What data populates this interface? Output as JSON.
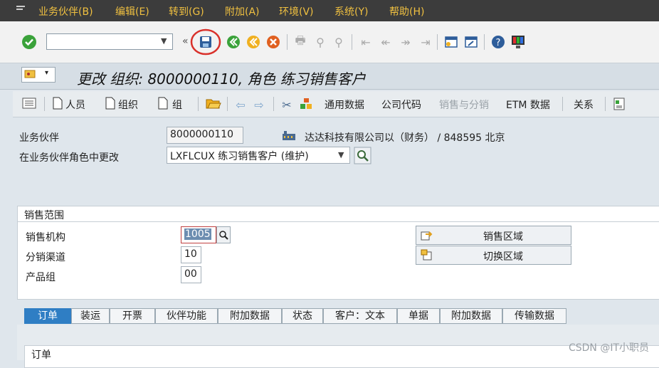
{
  "menu": {
    "items": [
      "业务伙伴(B)",
      "编辑(E)",
      "转到(G)",
      "附加(A)",
      "环境(V)",
      "系统(Y)",
      "帮助(H)"
    ]
  },
  "toolbar": {
    "command_value": "",
    "icons": [
      "check-icon",
      "save-icon",
      "back-icon",
      "exit-icon",
      "cancel-icon",
      "print-icon",
      "find-icon",
      "find-next-icon",
      "first-page-icon",
      "prev-page-icon",
      "next-page-icon",
      "last-page-icon",
      "new-session-icon",
      "shortcut-icon",
      "help-icon",
      "layout-icon"
    ]
  },
  "title": "更改 组织: 8000000110, 角色 练习销售客户",
  "app_toolbar": {
    "person": "人员",
    "org": "组织",
    "group": "组",
    "general_data": "通用数据",
    "company_code": "公司代码",
    "sales_distribution": "销售与分销",
    "etm_data": "ETM 数据",
    "relations": "关系"
  },
  "header": {
    "bp_label": "业务伙伴",
    "bp_value": "8000000110",
    "bp_desc": "达达科技有限公司以（财务） / 848595 北京",
    "role_label": "在业务伙伴角色中更改",
    "role_value": "LXFLCUX 练习销售客户 (维护)"
  },
  "sales_area": {
    "title": "销售范围",
    "sales_org_label": "销售机构",
    "sales_org_value": "1005",
    "channel_label": "分销渠道",
    "channel_value": "10",
    "division_label": "产品组",
    "division_value": "00",
    "sales_areas_button": "销售区域",
    "switch_area_button": "切换区域"
  },
  "tabs": [
    "订单",
    "装运",
    "开票",
    "伙伴功能",
    "附加数据",
    "状态",
    "客户：文本",
    "单据",
    "附加数据",
    "传输数据"
  ],
  "order_section": {
    "title": "订单"
  },
  "watermark": "CSDN @IT小职员",
  "colors": {
    "menu_bg": "#3c3c3c",
    "menu_text": "#f0c040",
    "tab_active": "#2f7ec4",
    "highlight": "#d9312b"
  }
}
